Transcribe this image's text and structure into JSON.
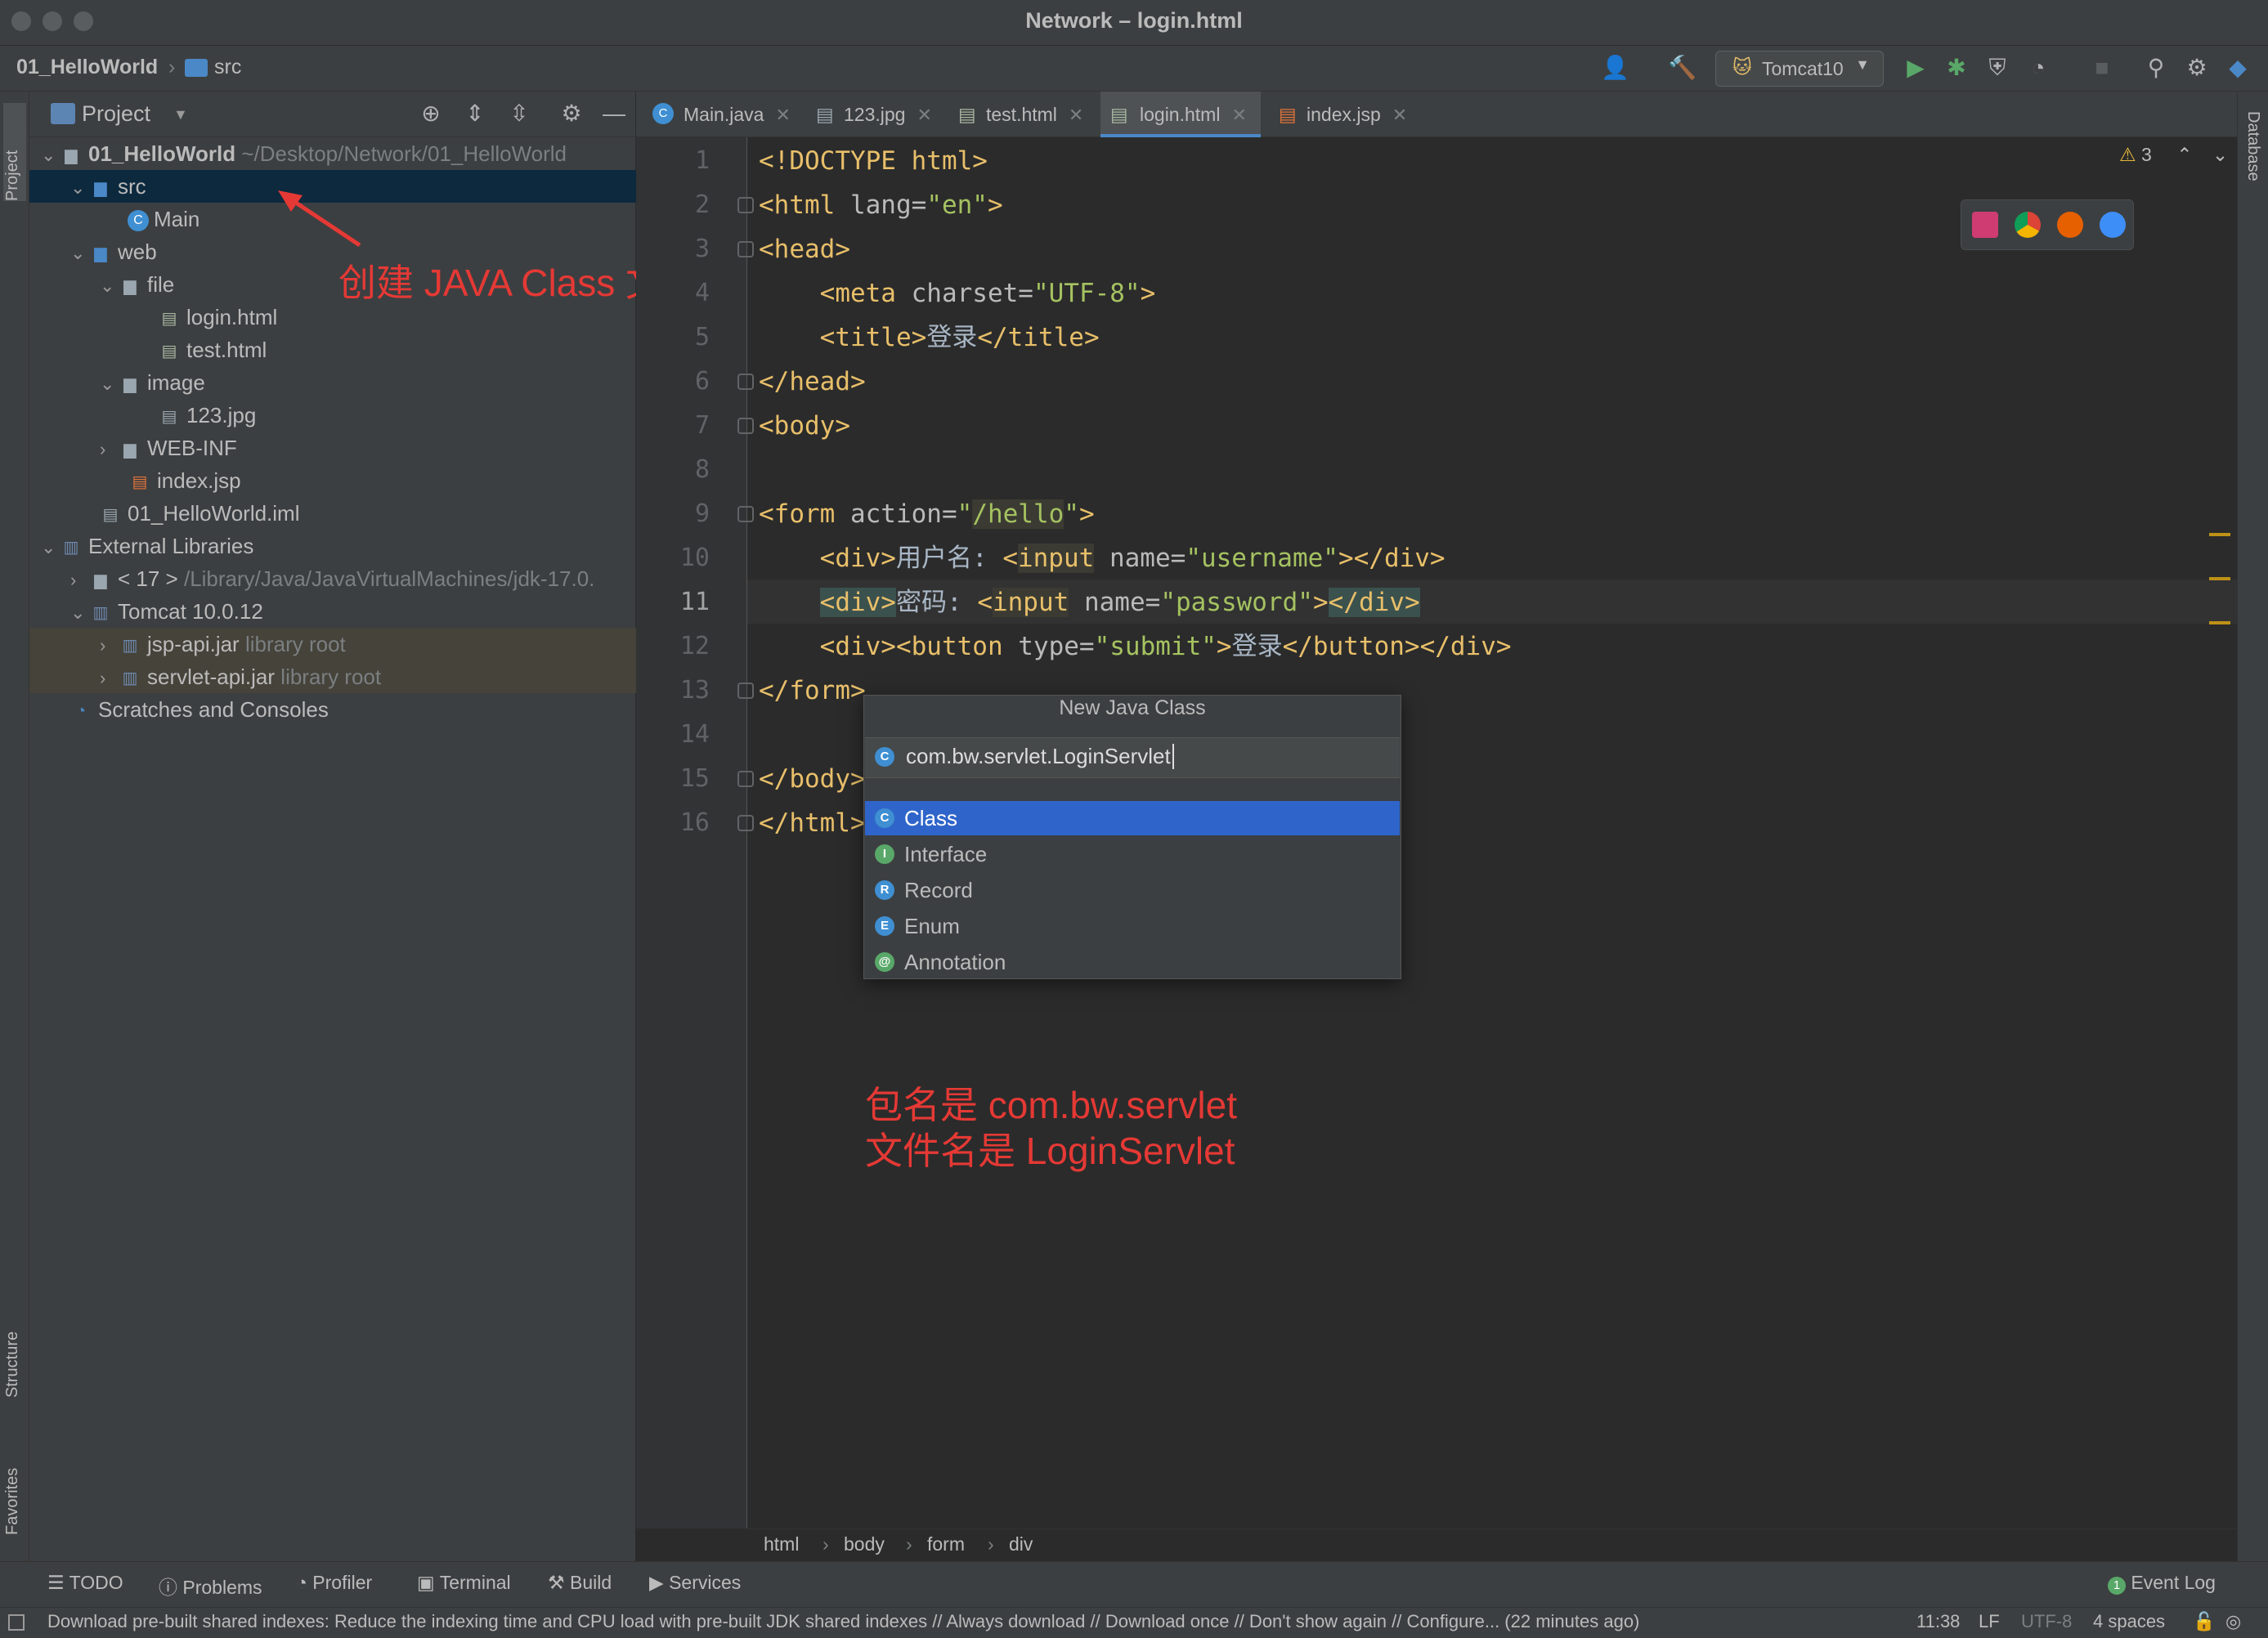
{
  "window": {
    "title": "Network – login.html"
  },
  "navbar": {
    "project": "01_HelloWorld",
    "folder": "src",
    "run_config": "Tomcat10"
  },
  "side_tabs": {
    "project": "Project",
    "structure": "Structure",
    "favorites": "Favorites",
    "database": "Database"
  },
  "project_panel": {
    "title": "Project",
    "tree": [
      {
        "label": "01_HelloWorld",
        "hint": "~/Desktop/Network/01_HelloWorld"
      },
      {
        "label": "src"
      },
      {
        "label": "Main"
      },
      {
        "label": "web"
      },
      {
        "label": "file"
      },
      {
        "label": "login.html"
      },
      {
        "label": "test.html"
      },
      {
        "label": "image"
      },
      {
        "label": "123.jpg"
      },
      {
        "label": "WEB-INF"
      },
      {
        "label": "index.jsp"
      },
      {
        "label": "01_HelloWorld.iml"
      },
      {
        "label": "External Libraries"
      },
      {
        "label": "< 17 >",
        "hint": "/Library/Java/JavaVirtualMachines/jdk-17.0."
      },
      {
        "label": "Tomcat 10.0.12"
      },
      {
        "label": "jsp-api.jar",
        "hint": "library root"
      },
      {
        "label": "servlet-api.jar",
        "hint": "library root"
      },
      {
        "label": "Scratches and Consoles"
      }
    ]
  },
  "tabs": [
    {
      "label": "Main.java"
    },
    {
      "label": "123.jpg"
    },
    {
      "label": "test.html"
    },
    {
      "label": "login.html"
    },
    {
      "label": "index.jsp"
    }
  ],
  "editor": {
    "line_numbers": [
      "1",
      "2",
      "3",
      "4",
      "5",
      "6",
      "7",
      "8",
      "9",
      "10",
      "11",
      "12",
      "13",
      "14",
      "15",
      "16"
    ],
    "warning_count": "3"
  },
  "popup": {
    "title": "New Java Class",
    "input_value": "com.bw.servlet.LoginServlet",
    "items": [
      {
        "label": "Class",
        "badge": "C"
      },
      {
        "label": "Interface",
        "badge": "I"
      },
      {
        "label": "Record",
        "badge": "R"
      },
      {
        "label": "Enum",
        "badge": "E"
      },
      {
        "label": "Annotation",
        "badge": "@"
      }
    ]
  },
  "annotations": {
    "create_class": "创建 JAVA Class 文件",
    "package_line": "包名是 com.bw.servlet",
    "file_line": "文件名是 LoginServlet"
  },
  "breadcrumb": [
    "html",
    "body",
    "form",
    "div"
  ],
  "tool_windows": [
    "TODO",
    "Problems",
    "Profiler",
    "Terminal",
    "Build",
    "Services",
    "Event Log"
  ],
  "event_log_count": "1",
  "status": {
    "message": "Download pre-built shared indexes: Reduce the indexing time and CPU load with pre-built JDK shared indexes // Always download // Download once // Don't show again // Configure... (22 minutes ago)",
    "position": "11:38",
    "line_sep": "LF",
    "encoding": "UTF-8",
    "indent": "4 spaces"
  },
  "colors": {
    "accent": "#2f65ca",
    "annotation": "#e53935"
  }
}
